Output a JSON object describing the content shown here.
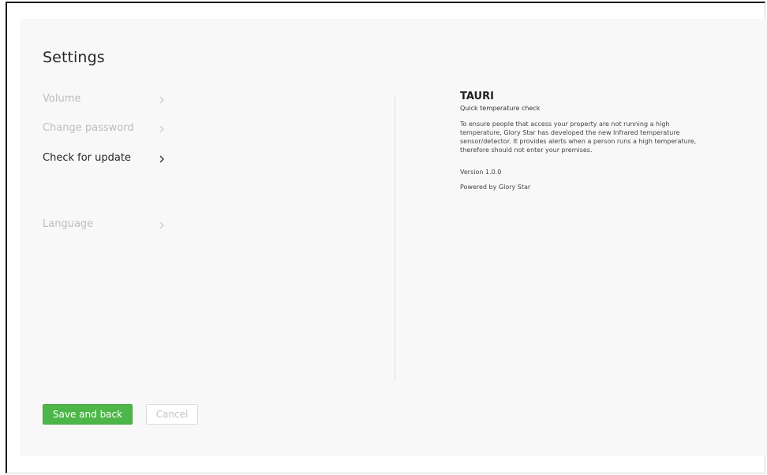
{
  "settings": {
    "title": "Settings"
  },
  "menu": {
    "items": [
      {
        "label": "Volume",
        "state": "inactive"
      },
      {
        "label": "Change password",
        "state": "inactive"
      },
      {
        "label": "Check for update",
        "state": "active"
      },
      {
        "label": "Language",
        "state": "inactive"
      }
    ],
    "chevron_icon": "chevron-right-icon"
  },
  "info": {
    "app_name": "TAURI",
    "subtitle": "Quick temperature check",
    "description": "To ensure people that access your property are not running a high temperature, Glory Star has developed the new Infrared temperature sensor/detector. It provides alerts when a person runs a high temperature, therefore should not enter your premises.",
    "version": "Version 1.0.0",
    "powered_by": "Powered by Glory Star"
  },
  "buttons": {
    "save_label": "Save and back",
    "cancel_label": "Cancel"
  },
  "colors": {
    "accent": "#4cb648",
    "text_active": "#262626",
    "text_inactive": "#bdbdbd"
  }
}
